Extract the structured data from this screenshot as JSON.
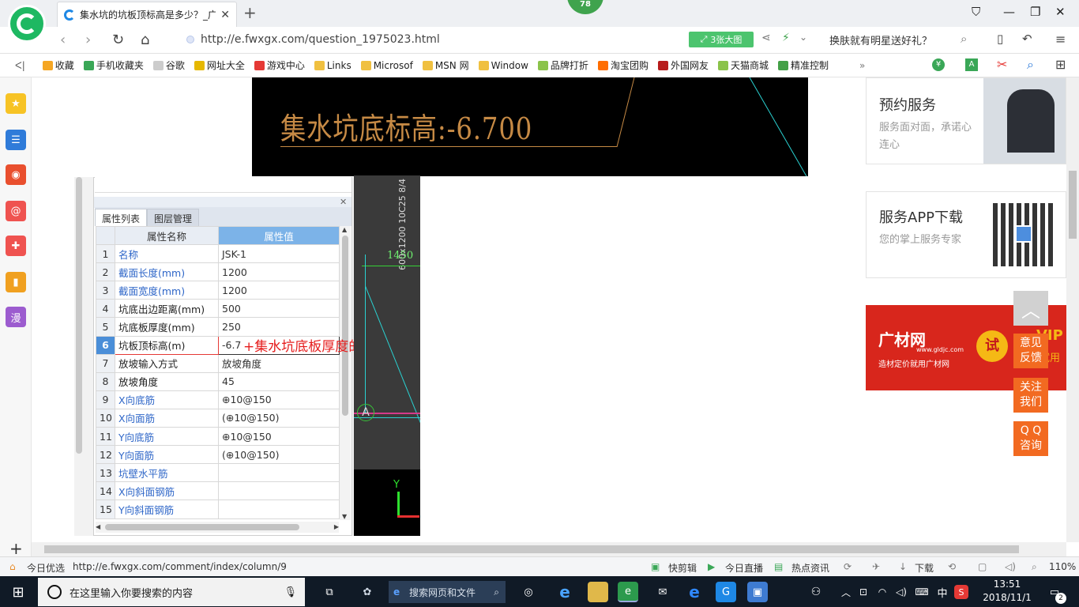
{
  "browser": {
    "tab_title": "集水坑的坑板顶标高是多少？_广",
    "notification_badge": "78",
    "url": "http://e.fwxgx.com/question_1975023.html",
    "big_image_label": "3张大图",
    "search_hint": "换肤就有明星送好礼？"
  },
  "bookmarks": [
    {
      "label": "收藏",
      "color": "#f5a623"
    },
    {
      "label": "手机收藏夹",
      "color": "#3aa757"
    },
    {
      "label": "谷歌",
      "color": "#cccccc"
    },
    {
      "label": "网址大全",
      "color": "#e6b800"
    },
    {
      "label": "游戏中心",
      "color": "#e53935"
    },
    {
      "label": "Links",
      "color": "#f0c040"
    },
    {
      "label": "Microsof",
      "color": "#f0c040"
    },
    {
      "label": "MSN 网",
      "color": "#f0c040"
    },
    {
      "label": "Window",
      "color": "#f0c040"
    },
    {
      "label": "品牌打折",
      "color": "#8bc34a"
    },
    {
      "label": "淘宝团购",
      "color": "#ff6d00"
    },
    {
      "label": "外国网友",
      "color": "#b71c1c"
    },
    {
      "label": "天猫商城",
      "color": "#8bc34a"
    },
    {
      "label": "精准控制",
      "color": "#43a047"
    }
  ],
  "sidebar_icons": [
    {
      "name": "favorites-icon",
      "color": "#f7c325",
      "glyph": "★"
    },
    {
      "name": "apps-icon",
      "color": "#2f7bd9",
      "glyph": "☰"
    },
    {
      "name": "weibo-icon",
      "color": "#e94f2e",
      "glyph": "◉"
    },
    {
      "name": "mail-icon",
      "color": "#ef5350",
      "glyph": "@"
    },
    {
      "name": "game-icon",
      "color": "#ef5350",
      "glyph": "✚"
    },
    {
      "name": "book-icon",
      "color": "#f0a020",
      "glyph": "▮"
    },
    {
      "name": "comic-icon",
      "color": "#9c5ccf",
      "glyph": "漫"
    }
  ],
  "cad_top_text": "集水坑底标高:-6.700",
  "property_panel": {
    "tabs": [
      "属性列表",
      "图层管理"
    ],
    "headers": [
      "属性名称",
      "属性值"
    ],
    "rows": [
      {
        "idx": "1",
        "name": "名称",
        "value": "JSK-1",
        "blue": true
      },
      {
        "idx": "2",
        "name": "截面长度(mm)",
        "value": "1200",
        "blue": true
      },
      {
        "idx": "3",
        "name": "截面宽度(mm)",
        "value": "1200",
        "blue": true
      },
      {
        "idx": "4",
        "name": "坑底出边距离(mm)",
        "value": "500",
        "blue": false
      },
      {
        "idx": "5",
        "name": "坑底板厚度(mm)",
        "value": "250",
        "blue": false
      },
      {
        "idx": "6",
        "name": "坑板顶标高(m)",
        "value": "-6.7",
        "blue": false,
        "selected": true
      },
      {
        "idx": "7",
        "name": "放坡输入方式",
        "value": "放坡角度",
        "blue": false
      },
      {
        "idx": "8",
        "name": "放坡角度",
        "value": "45",
        "blue": false
      },
      {
        "idx": "9",
        "name": "X向底筋",
        "value": "⊕10@150",
        "blue": true
      },
      {
        "idx": "10",
        "name": "X向面筋",
        "value": "(⊕10@150)",
        "blue": true
      },
      {
        "idx": "11",
        "name": "Y向底筋",
        "value": "⊕10@150",
        "blue": true
      },
      {
        "idx": "12",
        "name": "Y向面筋",
        "value": "(⊕10@150)",
        "blue": true
      },
      {
        "idx": "13",
        "name": "坑壁水平筋",
        "value": "",
        "blue": true
      },
      {
        "idx": "14",
        "name": "X向斜面钢筋",
        "value": "",
        "blue": true
      },
      {
        "idx": "15",
        "name": "Y向斜面钢筋",
        "value": "",
        "blue": true
      }
    ],
    "annotation": "+集水坑底板厚度的"
  },
  "cad_mid": {
    "vertical_text": "600x1200 10C25 8/4",
    "dimension": "1450",
    "axis_label": "A",
    "y_label": "Y"
  },
  "right_column": {
    "service_title": "预约服务",
    "service_desc": "服务面对面，承诺心连心",
    "app_title": "服务APP下载",
    "app_desc": "您的掌上服务专家",
    "ad_brand": "广材网",
    "ad_url": "www.gldjc.com",
    "ad_sub": "造材定价就用广材网",
    "ad_try": "试",
    "ad_vip": "VIP",
    "ad_trial": "试用",
    "btn_feedback": "意见\n反馈",
    "btn_follow": "关注\n我们",
    "btn_qq": "Q Q\n咨询"
  },
  "statusbar": {
    "today": "今日优选",
    "link": "http://e.fwxgx.com/comment/index/column/9",
    "quickcut": "快剪辑",
    "live": "今日直播",
    "news": "热点资讯",
    "download": "下载",
    "zoom": "110%"
  },
  "taskbar": {
    "search_placeholder": "在这里输入你要搜索的内容",
    "web_search": "搜索网页和文件",
    "ime": "中",
    "time": "13:51",
    "date": "2018/11/1",
    "notifications": "2"
  }
}
